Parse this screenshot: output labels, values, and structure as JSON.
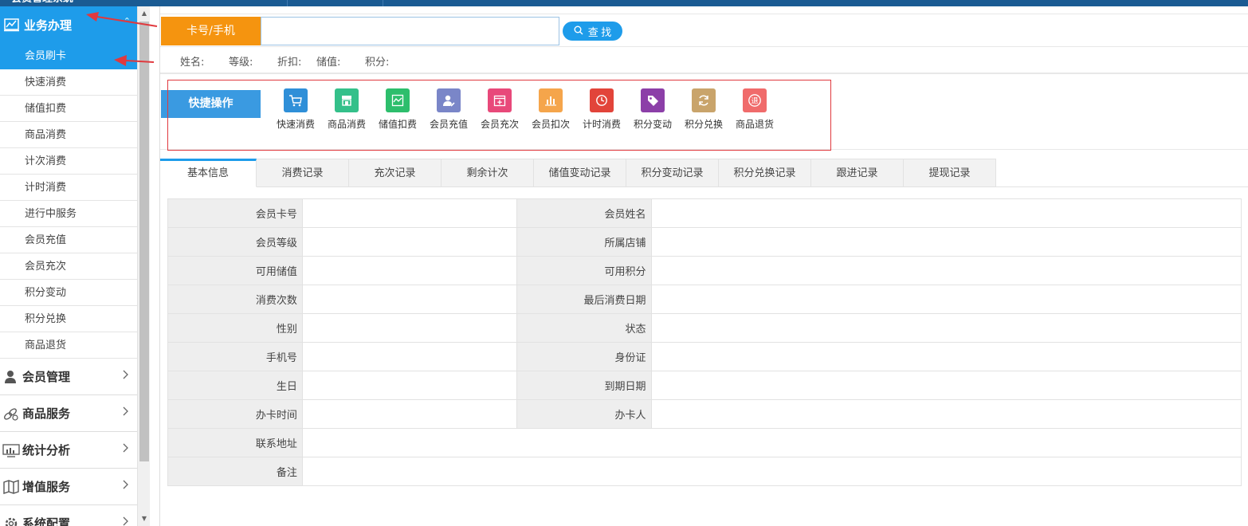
{
  "sidebar": {
    "header": "业务办理",
    "sub_items": [
      {
        "label": "会员刷卡"
      },
      {
        "label": "快速消费"
      },
      {
        "label": "储值扣费"
      },
      {
        "label": "商品消费"
      },
      {
        "label": "计次消费"
      },
      {
        "label": "计时消费"
      },
      {
        "label": "进行中服务"
      },
      {
        "label": "会员充值"
      },
      {
        "label": "会员充次"
      },
      {
        "label": "积分变动"
      },
      {
        "label": "积分兑换"
      },
      {
        "label": "商品退货"
      }
    ],
    "sections": [
      {
        "label": "会员管理",
        "icon": "person-icon"
      },
      {
        "label": "商品服务",
        "icon": "link-icon"
      },
      {
        "label": "统计分析",
        "icon": "monitor-chart-icon"
      },
      {
        "label": "增值服务",
        "icon": "map-icon"
      },
      {
        "label": "系统配置",
        "icon": "gear-icon"
      }
    ]
  },
  "search": {
    "label": "卡号/手机",
    "value": "",
    "button": "查 找"
  },
  "member_info_bar": {
    "name": "姓名:",
    "level": "等级:",
    "discount": "折扣:",
    "stored_value": "储值:",
    "points": "积分:"
  },
  "quick_ops": {
    "label": "快捷操作",
    "items": [
      {
        "label": "快速消费",
        "icon": "cart-icon",
        "color": "#2f8fd8"
      },
      {
        "label": "商品消费",
        "icon": "store-icon",
        "color": "#34c08a"
      },
      {
        "label": "储值扣费",
        "icon": "wave-chart-icon",
        "color": "#2dbe6c"
      },
      {
        "label": "会员充值",
        "icon": "user-edit-icon",
        "color": "#7a86c8"
      },
      {
        "label": "会员充次",
        "icon": "calendar-plus-icon",
        "color": "#e8497a"
      },
      {
        "label": "会员扣次",
        "icon": "bar-chart-icon",
        "color": "#f5a54b"
      },
      {
        "label": "计时消费",
        "icon": "clock-icon",
        "color": "#e2443a"
      },
      {
        "label": "积分变动",
        "icon": "tag-icon",
        "color": "#8c3fa8"
      },
      {
        "label": "积分兑换",
        "icon": "refresh-icon",
        "color": "#c9a46b"
      },
      {
        "label": "商品退货",
        "icon": "return-icon",
        "color": "#f06b6b"
      }
    ]
  },
  "tabs": [
    {
      "label": "基本信息"
    },
    {
      "label": "消费记录"
    },
    {
      "label": "充次记录"
    },
    {
      "label": "剩余计次"
    },
    {
      "label": "储值变动记录"
    },
    {
      "label": "积分变动记录"
    },
    {
      "label": "积分兑换记录"
    },
    {
      "label": "跟进记录"
    },
    {
      "label": "提现记录"
    }
  ],
  "basic_info": {
    "rows": [
      [
        "会员卡号",
        "",
        "会员姓名",
        ""
      ],
      [
        "会员等级",
        "",
        "所属店铺",
        ""
      ],
      [
        "可用储值",
        "",
        "可用积分",
        ""
      ],
      [
        "消费次数",
        "",
        "最后消费日期",
        ""
      ],
      [
        "性别",
        "",
        "状态",
        ""
      ],
      [
        "手机号",
        "",
        "身份证",
        ""
      ],
      [
        "生日",
        "",
        "到期日期",
        ""
      ],
      [
        "办卡时间",
        "",
        "办卡人",
        ""
      ]
    ],
    "wide_rows": [
      [
        "联系地址",
        ""
      ],
      [
        "备注",
        ""
      ]
    ]
  },
  "colors": {
    "accent": "#1e9cea",
    "search_label_bg": "#f5940f",
    "quick_label_bg": "#3a9ae1",
    "highlight_border": "#e0393e",
    "annotation_arrow": "#e0393e"
  }
}
